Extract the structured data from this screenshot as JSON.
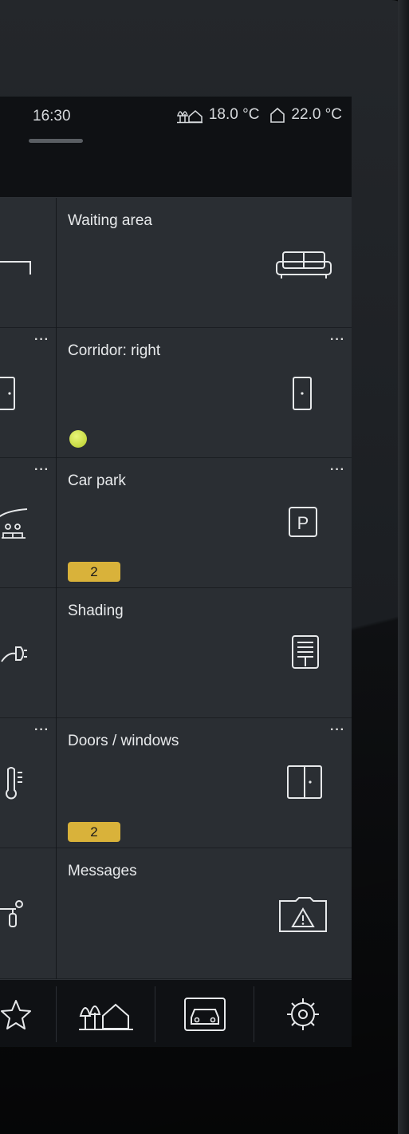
{
  "status_bar": {
    "time": "16:30",
    "outdoor_temp": "18.0 °C",
    "indoor_temp": "22.0 °C"
  },
  "tiles": [
    {
      "title": "Waiting area",
      "icon": "sofa-icon",
      "menu": ""
    },
    {
      "title": "Corridor: right",
      "icon": "door-icon",
      "menu": "···",
      "status": "on"
    },
    {
      "title": "Car park",
      "icon": "parking-icon",
      "menu": "···",
      "badge": "2"
    },
    {
      "title": "Shading",
      "icon": "blind-icon",
      "menu": ""
    },
    {
      "title": "Doors / windows",
      "icon": "window-icon",
      "menu": "···",
      "badge": "2"
    },
    {
      "title": "Messages",
      "icon": "warning-folder-icon",
      "menu": ""
    }
  ],
  "left_tiles_menu": [
    "",
    "···",
    "···",
    "",
    "···",
    ""
  ],
  "navbar": [
    "star-icon",
    "home-outdoor-icon",
    "car-icon",
    "settings-icon"
  ],
  "colors": {
    "badge": "#d9b23a",
    "status_dot": "#c6dc3a",
    "tile_bg": "#2a2e33"
  }
}
